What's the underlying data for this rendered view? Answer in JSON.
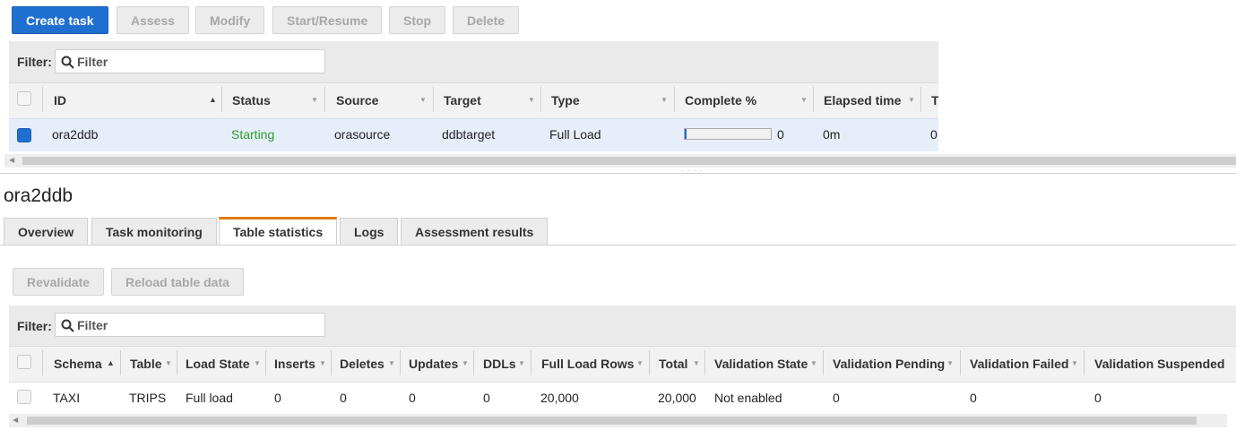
{
  "toolbar": {
    "create_task": "Create task",
    "assess": "Assess",
    "modify": "Modify",
    "start_resume": "Start/Resume",
    "stop": "Stop",
    "delete": "Delete"
  },
  "tasks_filter": {
    "label": "Filter:",
    "placeholder": "Filter"
  },
  "tasks_table": {
    "columns": [
      "ID",
      "Status",
      "Source",
      "Target",
      "Type",
      "Complete %",
      "Elapsed time",
      "T"
    ],
    "row": {
      "id": "ora2ddb",
      "status": "Starting",
      "source": "orasource",
      "target": "ddbtarget",
      "type": "Full Load",
      "complete_value": "0",
      "complete_fraction": 0.01,
      "elapsed": "0m",
      "t": "0"
    }
  },
  "detail": {
    "title": "ora2ddb",
    "tabs": [
      "Overview",
      "Task monitoring",
      "Table statistics",
      "Logs",
      "Assessment results"
    ],
    "active_tab": "Table statistics"
  },
  "stats_toolbar": {
    "revalidate": "Revalidate",
    "reload": "Reload table data"
  },
  "stats_filter": {
    "label": "Filter:",
    "placeholder": "Filter"
  },
  "stats_table": {
    "columns": [
      "Schema",
      "Table",
      "Load State",
      "Inserts",
      "Deletes",
      "Updates",
      "DDLs",
      "Full Load Rows",
      "Total",
      "Validation State",
      "Validation Pending",
      "Validation Failed",
      "Validation Suspended"
    ],
    "row": [
      "TAXI",
      "TRIPS",
      "Full load",
      "0",
      "0",
      "0",
      "0",
      "20,000",
      "20,000",
      "Not enabled",
      "0",
      "0",
      "0"
    ]
  },
  "colors": {
    "primary": "#1f6fd1",
    "status_starting": "#2e9a2e",
    "active_tab": "#e07b00"
  },
  "icons": [
    "search-icon",
    "sort-asc-icon",
    "sort-desc-icon",
    "scroll-left-icon"
  ]
}
